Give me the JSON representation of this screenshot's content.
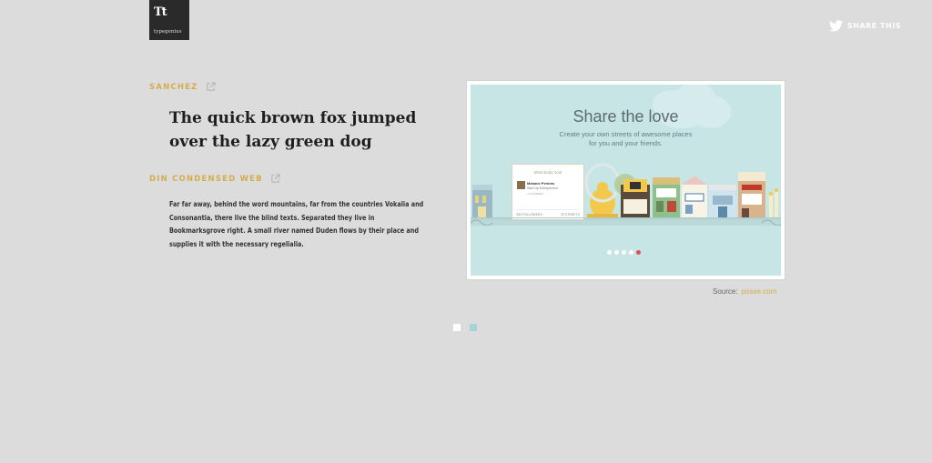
{
  "logo": {
    "mark": "Tt",
    "wordmark": "typegenius"
  },
  "share": {
    "label": "SHARE THIS",
    "icon": "twitter-icon"
  },
  "fonts": [
    {
      "name": "SANCHEZ",
      "icon": "external-link-icon"
    },
    {
      "name": "DIN CONDENSED WEB",
      "icon": "external-link-icon"
    }
  ],
  "samples": {
    "heading": "The quick brown fox jumped over the lazy green dog",
    "body": "Far far away, behind the word mountains, far from the countries Vokalia and Consonantia, there live the blind texts. Separated they live in Bookmarksgrove right. A small river named Duden flows by their place and supplies it with the necessary regelialia."
  },
  "preview": {
    "title": "Share the love",
    "subtitle_line1": "Create your own streets of awesome places",
    "subtitle_line2": "for you and your friends.",
    "card_title": "Mind body soul",
    "card_name": "Melanie Perkins",
    "card_role": "Start Up Entrepreneur",
    "card_link": "» IN STREET",
    "card_followers": "359 FOLLOWERS",
    "card_streets": "29 STREETS",
    "slide_count": 5,
    "active_slide": 5
  },
  "source": {
    "label": "Source:",
    "link": "posse.com"
  },
  "pager": {
    "count": 2,
    "active": 1
  },
  "colors": {
    "accent": "#d3ad4e",
    "background": "#dcdcdc",
    "preview_bg": "#c8e5e6",
    "active_dot": "#d9534f"
  }
}
